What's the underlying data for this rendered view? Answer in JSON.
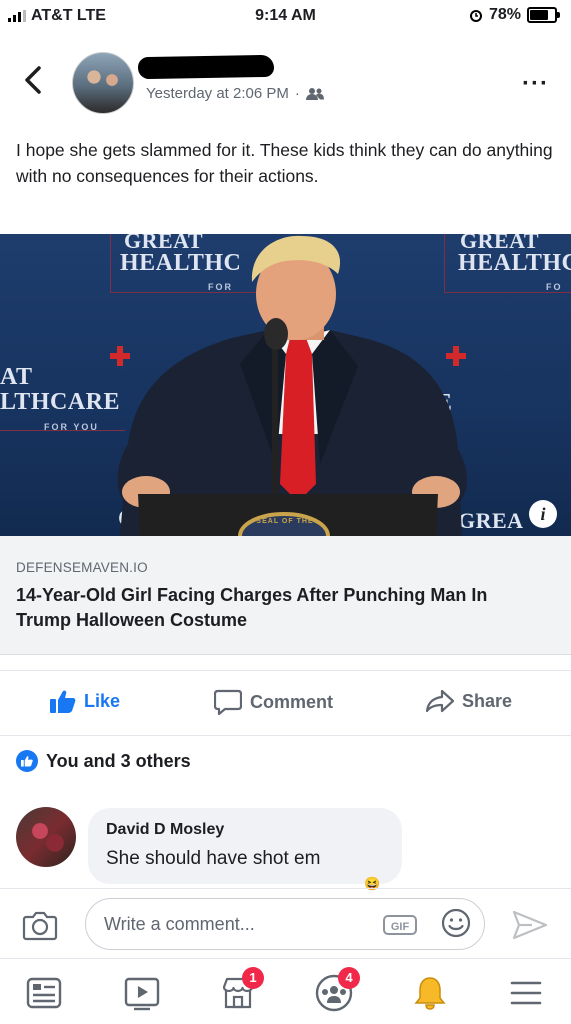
{
  "status_bar": {
    "carrier": "AT&T LTE",
    "time": "9:14 AM",
    "battery_text": "78%",
    "battery_level": 0.78
  },
  "post": {
    "timestamp": "Yesterday at 2:06 PM",
    "separator": "·",
    "audience_icon": "friends-icon",
    "more_label": "···",
    "text": "I hope she gets slammed for it. These kids think they can do anything with no consequences for their actions."
  },
  "link": {
    "image_text": {
      "left_top": "GREAT",
      "left_main": "HEALTHC",
      "left_for": "FOR",
      "right_top": "GREAT",
      "right_main": "HEALTHC",
      "right_for": "FO",
      "far_left_top": "AT",
      "far_left_main": "LTHCARE",
      "far_left_for": "FOR YOU",
      "right_mid": "RE",
      "right_mid_for": "U",
      "bottom_left": "C",
      "bottom_right": "GREA",
      "seal_text": "SEAL OF THE"
    },
    "info_label": "i",
    "domain": "DEFENSEMAVEN.IO",
    "title": "14-Year-Old Girl Facing Charges After Punching Man In Trump Halloween Costume"
  },
  "actions": {
    "like": "Like",
    "comment": "Comment",
    "share": "Share"
  },
  "reactions": {
    "summary": "You and 3 others"
  },
  "comment": {
    "author": "David D Mosley",
    "text": "She should have shot em",
    "reaction_emoji": "😆"
  },
  "composer": {
    "placeholder": "Write a comment...",
    "gif_label": "GIF"
  },
  "bottom_nav": {
    "marketplace_badge": "1",
    "groups_badge": "4"
  },
  "colors": {
    "brand_blue": "#1877f2",
    "badge_red": "#f02849",
    "notification_yellow": "#f7b928"
  }
}
